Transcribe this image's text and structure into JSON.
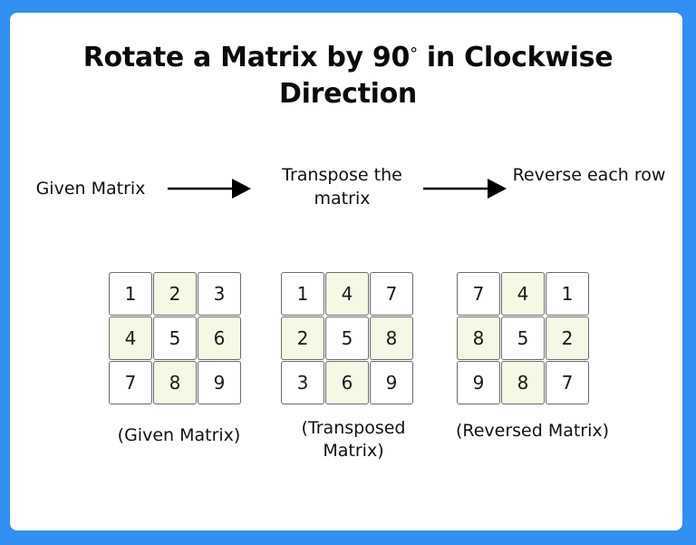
{
  "title": {
    "line1_pre": "Rotate a Matrix by 90",
    "degree": "°",
    "line1_post": " in Clockwise",
    "line2": "Direction"
  },
  "colors": {
    "background": "#318ff1",
    "card": "#ffffff",
    "highlight_cell": "#f7f7e6",
    "cell_border": "#6b6b6b"
  },
  "steps": [
    {
      "label": "Given Matrix"
    },
    {
      "label": "Transpose the matrix"
    },
    {
      "label": "Reverse each row"
    }
  ],
  "arrows": [
    {
      "from": "Given Matrix",
      "to": "Transpose the matrix",
      "icon": "right-arrow-icon"
    },
    {
      "from": "Transpose the matrix",
      "to": "Reverse each row",
      "icon": "right-arrow-icon"
    }
  ],
  "matrices": [
    {
      "name": "given",
      "caption": "(Given Matrix)",
      "cells": [
        [
          "1",
          "2",
          "3"
        ],
        [
          "4",
          "5",
          "6"
        ],
        [
          "7",
          "8",
          "9"
        ]
      ]
    },
    {
      "name": "transposed",
      "caption": "(Transposed Matrix)",
      "cells": [
        [
          "1",
          "4",
          "7"
        ],
        [
          "2",
          "5",
          "8"
        ],
        [
          "3",
          "6",
          "9"
        ]
      ]
    },
    {
      "name": "reversed",
      "caption": "(Reversed Matrix)",
      "cells": [
        [
          "7",
          "4",
          "1"
        ],
        [
          "8",
          "5",
          "2"
        ],
        [
          "9",
          "8",
          "7"
        ]
      ]
    }
  ],
  "highlight_pattern": [
    [
      false,
      true,
      false
    ],
    [
      true,
      false,
      true
    ],
    [
      false,
      true,
      false
    ]
  ]
}
